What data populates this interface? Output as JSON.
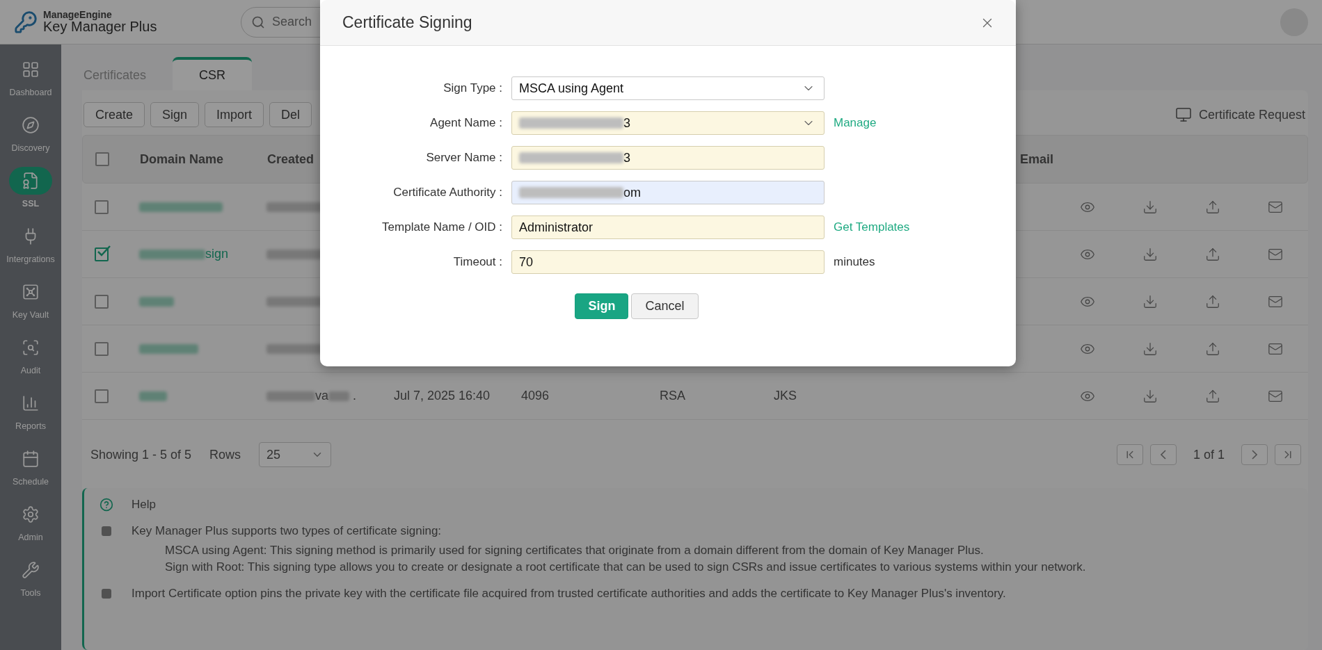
{
  "header": {
    "brand_top": "ManageEngine",
    "brand_name": "Key Manager",
    "brand_suffix": "Plus",
    "search": {
      "placeholder": "Search"
    }
  },
  "sidebar": {
    "items": [
      {
        "label": "Dashboard",
        "selected": false
      },
      {
        "label": "Discovery",
        "selected": false
      },
      {
        "label": "SSL",
        "selected": true
      },
      {
        "label": "Intergrations",
        "selected": false
      },
      {
        "label": "Key Vault",
        "selected": false
      },
      {
        "label": "Audit",
        "selected": false
      },
      {
        "label": "Reports",
        "selected": false
      },
      {
        "label": "Schedule",
        "selected": false
      },
      {
        "label": "Admin",
        "selected": false
      },
      {
        "label": "Tools",
        "selected": false
      }
    ]
  },
  "tabs": [
    {
      "label": "Certificates",
      "selected": false
    },
    {
      "label": "CSR",
      "selected": true
    }
  ],
  "toolbar": {
    "buttons": [
      "Create",
      "Sign",
      "Import",
      "Del"
    ],
    "request_link": "Certificate Request"
  },
  "table": {
    "header_checked": false,
    "columns": {
      "domain": "Domain Name",
      "created_by": "Created",
      "email": "Email"
    },
    "rows": [
      {
        "checked": false
      },
      {
        "checked": true,
        "domain": "sign"
      },
      {
        "checked": false
      },
      {
        "checked": false
      },
      {
        "checked": false,
        "created_by": "va",
        "created_by_tail": ".",
        "cells": [
          "Jul 7, 2025 16:40",
          "4096",
          "RSA",
          "JKS"
        ]
      }
    ]
  },
  "footer": {
    "showing": "Showing 1 - 5 of 5",
    "rows_label": "Rows",
    "rows_value": "25",
    "page": "1 of 1"
  },
  "help": {
    "title": "Help",
    "items": [
      {
        "text": "Key Manager Plus supports two types of certificate signing:",
        "details": [
          "MSCA using Agent: This signing method is primarily used for signing certificates that originate from a domain different from the domain of Key Manager Plus.",
          "Sign with Root: This signing type allows you to create or designate a root certificate that can be used to sign CSRs and issue certificates to various systems within your network."
        ]
      },
      {
        "text": "Import Certificate option pins the private key with the certificate file acquired from trusted certificate authorities and adds the certificate to Key Manager Plus's inventory."
      }
    ]
  },
  "dialog": {
    "title": "Certificate Signing",
    "fields": [
      {
        "label": "Sign Type :",
        "kind": "select",
        "highlighted": false,
        "autofilled": false,
        "blurred": false,
        "value": "MSCA using Agent"
      },
      {
        "label": "Agent Name :",
        "kind": "select",
        "highlighted": true,
        "autofilled": false,
        "blurred": true,
        "value": "3",
        "link": "Manage"
      },
      {
        "label": "Server Name :",
        "kind": "input",
        "highlighted": true,
        "autofilled": false,
        "blurred": true,
        "value": "3"
      },
      {
        "label": "Certificate Authority :",
        "kind": "input",
        "highlighted": false,
        "autofilled": true,
        "blurred": true,
        "value": "om"
      },
      {
        "label": "Template Name / OID :",
        "kind": "input",
        "highlighted": true,
        "autofilled": false,
        "blurred": false,
        "value": "Administrator",
        "link": "Get Templates"
      },
      {
        "label": "Timeout :",
        "kind": "input",
        "highlighted": true,
        "autofilled": false,
        "blurred": false,
        "value": "70",
        "suffix": "minutes"
      }
    ],
    "buttons": [
      {
        "label": "Sign",
        "primary": true
      },
      {
        "label": "Cancel",
        "primary": false
      }
    ]
  }
}
